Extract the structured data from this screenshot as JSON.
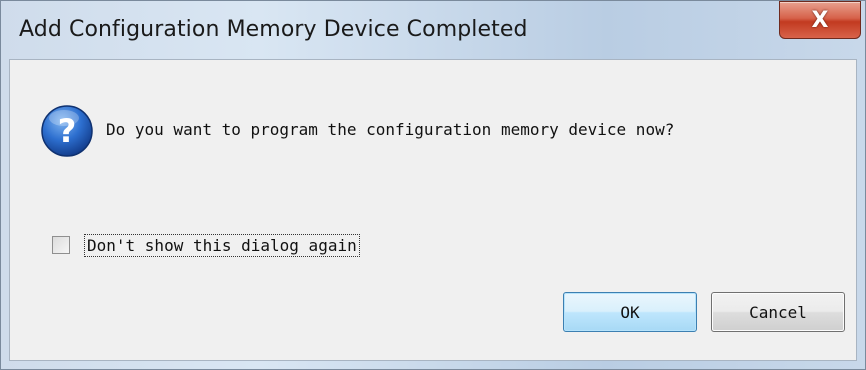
{
  "dialog": {
    "title": "Add Configuration Memory Device Completed",
    "close_glyph": "X",
    "icon": "question-icon",
    "message": "Do you want to program the configuration memory device now?",
    "checkbox": {
      "label": "Don't show this dialog again",
      "checked": false
    },
    "buttons": {
      "ok": "OK",
      "cancel": "Cancel"
    }
  },
  "colors": {
    "ok_border": "#3c7fb1",
    "close_red": "#c23a20",
    "icon_blue": "#1e5fbf"
  }
}
